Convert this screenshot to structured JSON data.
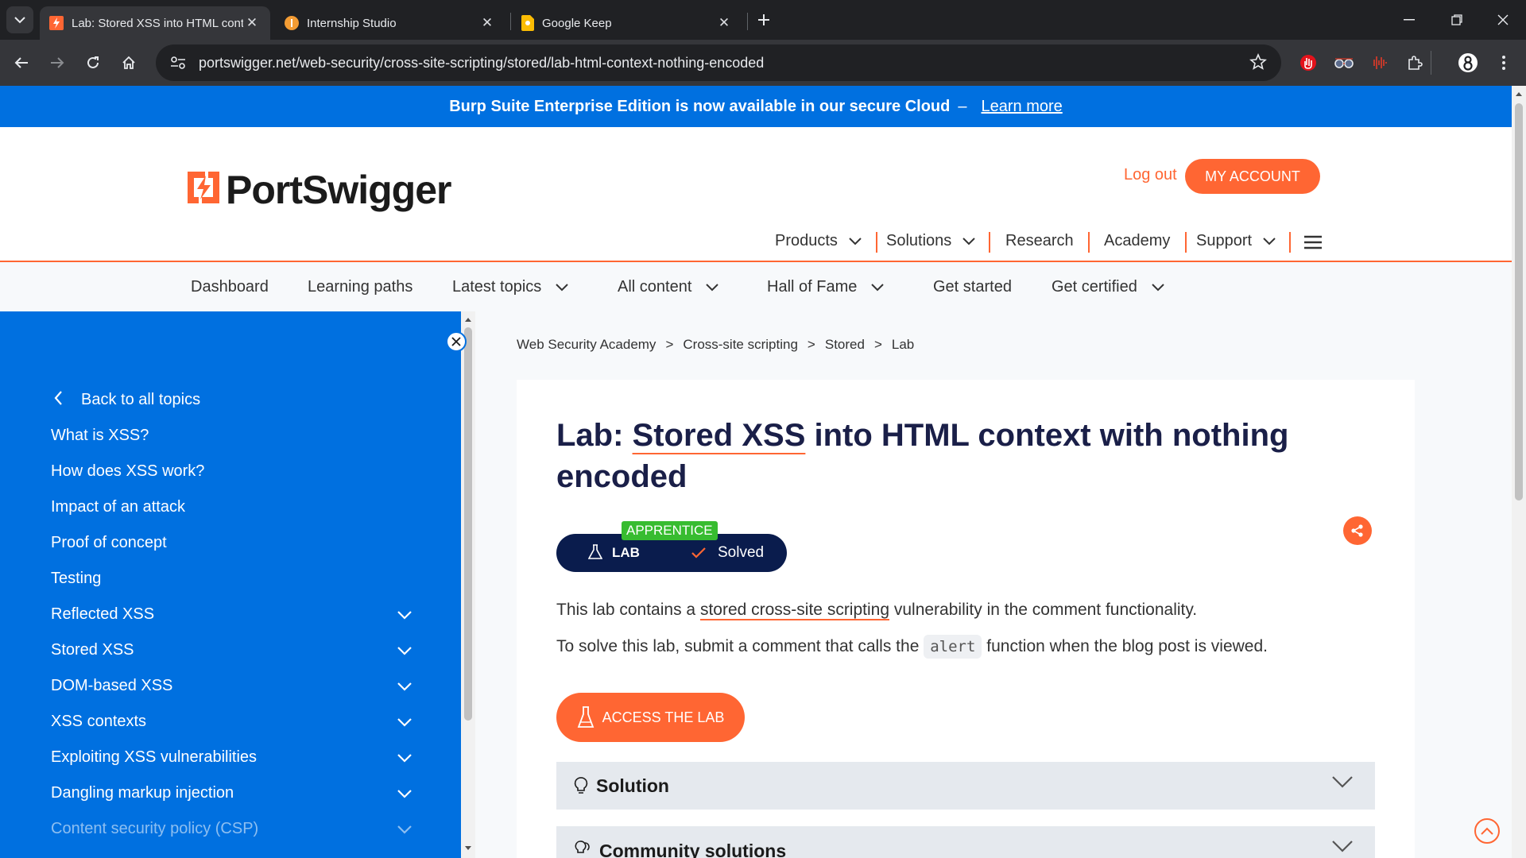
{
  "browser": {
    "tabs": [
      {
        "title": "Lab: Stored XSS into HTML cont",
        "active": true
      },
      {
        "title": "Internship Studio",
        "active": false
      },
      {
        "title": "Google Keep",
        "active": false
      }
    ],
    "url": "portswigger.net/web-security/cross-site-scripting/stored/lab-html-context-nothing-encoded"
  },
  "banner": {
    "text": "Burp Suite Enterprise Edition is now available in our secure Cloud",
    "dash": "–",
    "link": "Learn more"
  },
  "header": {
    "logo": "PortSwigger",
    "logout": "Log out",
    "account": "MY ACCOUNT",
    "nav": [
      "Products",
      "Solutions",
      "Research",
      "Academy",
      "Support"
    ]
  },
  "subnav": [
    "Dashboard",
    "Learning paths",
    "Latest topics",
    "All content",
    "Hall of Fame",
    "Get started",
    "Get certified"
  ],
  "sidebar": {
    "back": "Back to all topics",
    "items": [
      "What is XSS?",
      "How does XSS work?",
      "Impact of an attack",
      "Proof of concept",
      "Testing",
      "Reflected XSS",
      "Stored XSS",
      "DOM-based XSS",
      "XSS contexts",
      "Exploiting XSS vulnerabilities",
      "Dangling markup injection",
      "Content security policy (CSP)"
    ]
  },
  "breadcrumb": [
    "Web Security Academy",
    "Cross-site scripting",
    "Stored",
    "Lab"
  ],
  "breadcrumb_sep": ">",
  "lab": {
    "title_prefix": "Lab: ",
    "title_highlight": "Stored XSS",
    "title_rest": " into HTML context with nothing encoded",
    "level": "APPRENTICE",
    "badge": "LAB",
    "status": "Solved",
    "para1_pre": "This lab contains a ",
    "para1_link": "stored cross-site scripting",
    "para1_post": " vulnerability in the comment functionality.",
    "para2_pre": "To solve this lab, submit a comment that calls the ",
    "para2_code": "alert",
    "para2_post": " function when the blog post is viewed.",
    "access": "ACCESS THE LAB",
    "solution": "Solution",
    "community": "Community solutions"
  },
  "colors": {
    "accent": "#ff6633",
    "brand_blue": "#0070e0",
    "navy": "#1a1f48",
    "green": "#37bc30"
  }
}
